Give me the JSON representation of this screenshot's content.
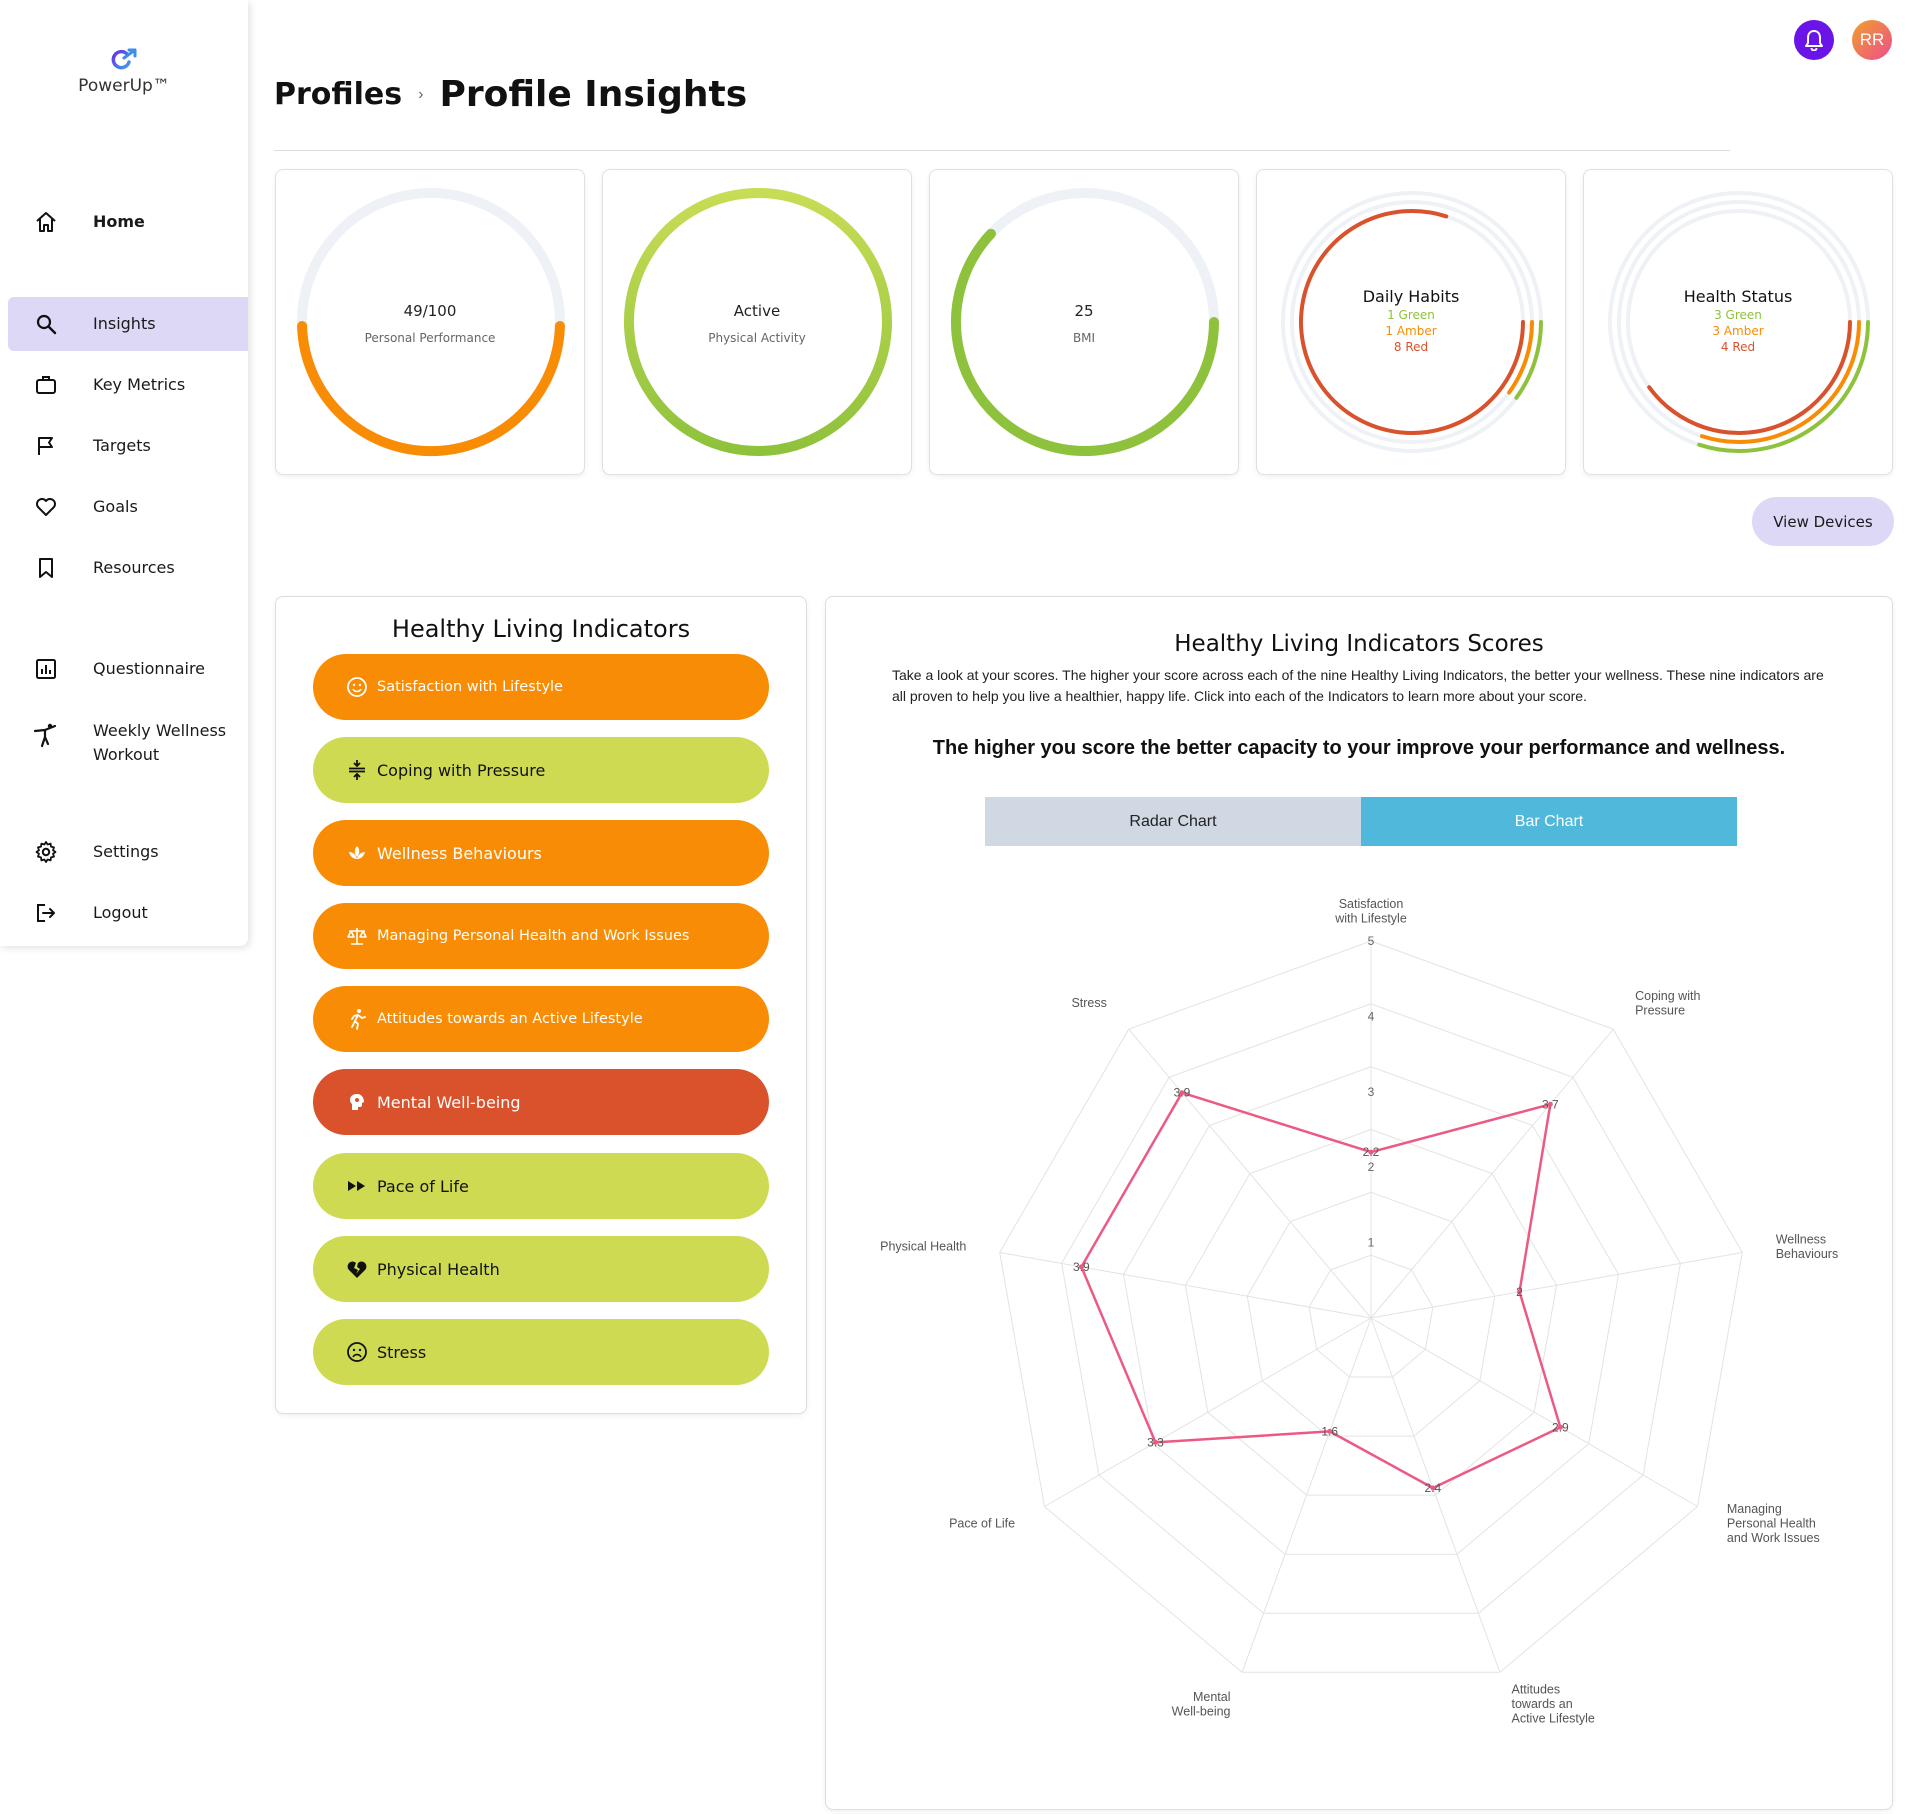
{
  "app": {
    "name": "PowerUp™"
  },
  "sidebar": {
    "items": [
      {
        "label": "Home",
        "icon": "home-icon"
      },
      {
        "label": "Insights",
        "icon": "search-icon",
        "active": true
      },
      {
        "label": "Key Metrics",
        "icon": "briefcase-icon"
      },
      {
        "label": "Targets",
        "icon": "flag-icon"
      },
      {
        "label": "Goals",
        "icon": "heart-icon"
      },
      {
        "label": "Resources",
        "icon": "bookmark-icon"
      },
      {
        "label": "Questionnaire",
        "icon": "bar-chart-icon"
      },
      {
        "label": "Weekly Wellness Workout",
        "line1": "Weekly Wellness",
        "line2": "Workout",
        "icon": "yoga-icon"
      },
      {
        "label": "Settings",
        "icon": "gear-icon"
      },
      {
        "label": "Logout",
        "icon": "logout-icon"
      }
    ]
  },
  "header": {
    "breadcrumb_parent": "Profiles",
    "breadcrumb_separator": "›",
    "title": "Profile Insights",
    "avatar_initials": "RR",
    "bell_color": "#6a14e8"
  },
  "gauges": [
    {
      "value": "49/100",
      "label": "Personal Performance",
      "fraction": 0.49,
      "color": "#f98c05"
    },
    {
      "value": "Active",
      "label": "Physical Activity",
      "fraction": 1.0,
      "color": "#8fc23c"
    },
    {
      "value": "25",
      "label": "BMI",
      "fraction": 0.62,
      "color": "#8fc23c"
    },
    {
      "title": "Daily Habits",
      "green": "1 Green",
      "amber": "1 Amber",
      "red": "8 Red",
      "counts": {
        "green": 1,
        "amber": 1,
        "red": 8
      }
    },
    {
      "title": "Health Status",
      "green": "3 Green",
      "amber": "3 Amber",
      "red": "4 Red",
      "counts": {
        "green": 3,
        "amber": 3,
        "red": 4
      }
    }
  ],
  "colors": {
    "green": "#8fc23c",
    "amber": "#f98c05",
    "red": "#d9522c",
    "lime": "#cedb52",
    "radar_line": "#ec5a84"
  },
  "view_devices_label": "View Devices",
  "indicators": {
    "title": "Healthy Living Indicators",
    "items": [
      {
        "label": "Satisfaction with Lifestyle",
        "status": "amber",
        "icon": "smile-icon"
      },
      {
        "label": "Coping with Pressure",
        "status": "lime",
        "icon": "compress-icon"
      },
      {
        "label": "Wellness Behaviours",
        "status": "amber",
        "icon": "lotus-icon"
      },
      {
        "label": "Managing Personal Health and Work Issues",
        "status": "amber",
        "icon": "scales-icon"
      },
      {
        "label": "Attitudes towards an Active Lifestyle",
        "status": "amber",
        "icon": "running-icon"
      },
      {
        "label": "Mental Well-being",
        "status": "red",
        "icon": "brain-icon"
      },
      {
        "label": "Pace of Life",
        "status": "lime",
        "icon": "fast-forward-icon"
      },
      {
        "label": "Physical Health",
        "status": "lime",
        "icon": "broken-heart-icon"
      },
      {
        "label": "Stress",
        "status": "lime",
        "icon": "sad-face-icon"
      }
    ]
  },
  "scores": {
    "title": "Healthy Living Indicators Scores",
    "description": "Take a look at your scores. The higher your score across each of the nine Healthy Living Indicators, the better your wellness. These nine indicators are all proven to help you live a healthier, happy life. Click into each of the Indicators to learn more about your score.",
    "emphasis": "The higher you score the better capacity to your improve your performance and wellness.",
    "tabs": {
      "radar": "Radar Chart",
      "bar": "Bar Chart"
    }
  },
  "chart_data": {
    "type": "radar",
    "title": "",
    "categories": [
      "Satisfaction with Lifestyle",
      "Coping with Pressure",
      "Wellness Behaviours",
      "Managing Personal Health and Work Issues",
      "Attitudes towards an Active Lifestyle",
      "Mental Well-being",
      "Pace of Life",
      "Physical Health",
      "Stress"
    ],
    "category_lines": [
      [
        "Satisfaction",
        "with Lifestyle"
      ],
      [
        "Coping with",
        "Pressure"
      ],
      [
        "Wellness",
        "Behaviours"
      ],
      [
        "Managing",
        "Personal Health",
        "and Work Issues"
      ],
      [
        "Attitudes",
        "towards an",
        "Active Lifestyle"
      ],
      [
        "Mental",
        "Well-being"
      ],
      [
        "Pace of Life"
      ],
      [
        "Physical Health"
      ],
      [
        "Stress"
      ]
    ],
    "series": [
      {
        "values": [
          2.2,
          3.7,
          2,
          2.9,
          2.4,
          1.6,
          3.3,
          3.9,
          3.9
        ]
      }
    ],
    "value_labels": [
      "2.2",
      "3.7",
      "2",
      "2.9",
      "2.4",
      "1.6",
      "3.3",
      "3.9",
      "3.9"
    ],
    "radial_ticks": [
      1,
      2,
      3,
      4,
      5
    ],
    "rlim": [
      0,
      5
    ],
    "grid": true
  }
}
